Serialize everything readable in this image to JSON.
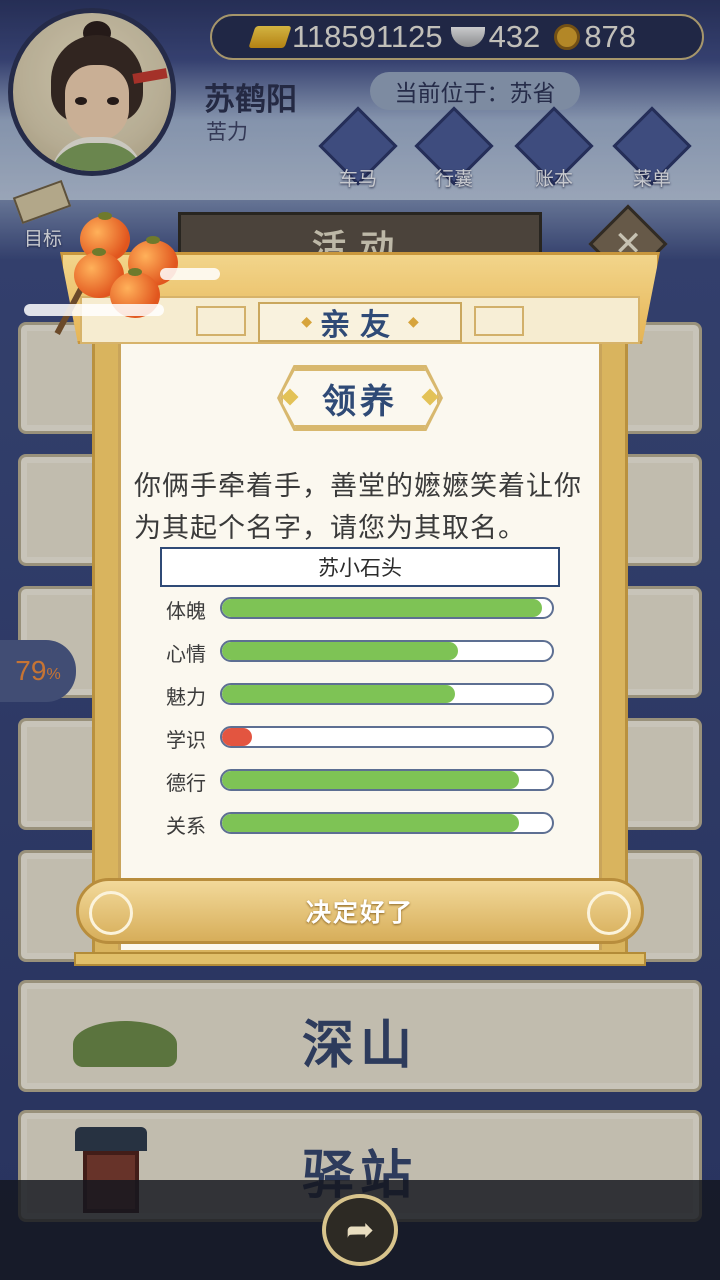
{
  "header": {
    "currency": {
      "gold": "118591125",
      "silver": "432",
      "coin": "878"
    },
    "player_name": "苏鹤阳",
    "player_sub": "苦力",
    "location": "当前位于：苏省",
    "nav": [
      "车马",
      "行囊",
      "账本",
      "菜单"
    ],
    "target_label": "目标"
  },
  "activity_tab": "活动",
  "close_symbol": "✕",
  "background_list": [
    {
      "name": "深山"
    },
    {
      "name": "驿站"
    }
  ],
  "percent": {
    "value": "79",
    "unit": "%"
  },
  "dialog": {
    "title": "亲友",
    "lead": "领养",
    "message": "你俩手牵着手，善堂的嬷嬷笑着让你为其起个名字，请您为其取名。",
    "name_value": "苏小石头",
    "stats": [
      {
        "label": "体魄",
        "value": 0.97,
        "color": "#7ec355"
      },
      {
        "label": "心情",
        "value": 0.715,
        "color": "#7ec355"
      },
      {
        "label": "魅力",
        "value": 0.705,
        "color": "#7ec355"
      },
      {
        "label": "学识",
        "value": 0.09,
        "color": "#e35540"
      },
      {
        "label": "德行",
        "value": 0.9,
        "color": "#7ec355"
      },
      {
        "label": "关系",
        "value": 0.9,
        "color": "#7ec355"
      }
    ],
    "confirm_label": "决定好了"
  },
  "icons": [
    "gold-ingot-icon",
    "silver-ingot-icon",
    "copper-coin-icon",
    "carriage-icon",
    "bag-icon",
    "ledger-icon",
    "menu-icon",
    "scroll-icon",
    "close-icon",
    "share-icon"
  ]
}
